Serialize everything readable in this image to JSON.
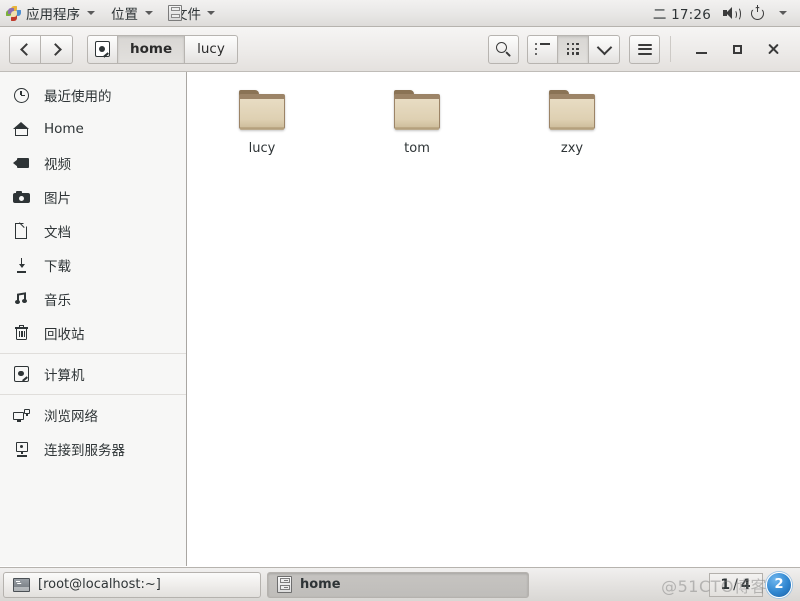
{
  "top_panel": {
    "logo_icon": "gnome-pinwheel-icon",
    "menus": [
      {
        "label": "应用程序",
        "icon": "applications-menu-icon",
        "has_caret": true
      },
      {
        "label": "位置",
        "icon": "places-menu-icon",
        "has_caret": true
      }
    ],
    "window_list": [
      {
        "label": "文件",
        "icon": "file-cabinet-icon",
        "has_caret": true
      }
    ],
    "clock": "二 17:26",
    "tray": [
      {
        "name": "volume-icon"
      },
      {
        "name": "power-icon"
      },
      {
        "name": "chevron-down-icon"
      }
    ]
  },
  "window": {
    "toolbar": {
      "back_label": "",
      "forward_label": "",
      "breadcrumb": [
        {
          "label": "",
          "icon": "drive-icon",
          "active": false
        },
        {
          "label": "home",
          "active": true
        },
        {
          "label": "lucy",
          "active": false
        }
      ],
      "search_icon": "search-icon",
      "view_buttons": [
        {
          "name": "list-view-icon",
          "active": false
        },
        {
          "name": "grid-view-icon",
          "active": true
        },
        {
          "name": "chevron-down-icon",
          "active": false
        }
      ],
      "menu_icon": "hamburger-menu-icon",
      "window_controls": [
        {
          "name": "minimize-button"
        },
        {
          "name": "maximize-button"
        },
        {
          "name": "close-button"
        }
      ]
    },
    "sidebar": {
      "items": [
        {
          "label": "最近使用的",
          "icon": "clock-icon"
        },
        {
          "label": "Home",
          "icon": "home-icon"
        },
        {
          "label": "视频",
          "icon": "video-icon"
        },
        {
          "label": "图片",
          "icon": "camera-icon"
        },
        {
          "label": "文档",
          "icon": "document-icon"
        },
        {
          "label": "下载",
          "icon": "download-icon"
        },
        {
          "label": "音乐",
          "icon": "music-icon"
        },
        {
          "label": "回收站",
          "icon": "trash-icon"
        },
        {
          "label": "计算机",
          "icon": "disk-icon"
        },
        {
          "label": "浏览网络",
          "icon": "network-icon"
        },
        {
          "label": "连接到服务器",
          "icon": "server-icon"
        }
      ]
    },
    "files": [
      {
        "name": "lucy",
        "type": "folder"
      },
      {
        "name": "tom",
        "type": "folder"
      },
      {
        "name": "zxy",
        "type": "folder"
      }
    ]
  },
  "taskbar": {
    "tasks": [
      {
        "label": "[root@localhost:~]",
        "icon": "terminal-icon",
        "active": false
      },
      {
        "label": "home",
        "icon": "file-cabinet-icon",
        "active": true
      }
    ],
    "workspace": {
      "current": "1",
      "separator": "/",
      "total": "4"
    },
    "badge": "2",
    "watermark": "@51CTO博客"
  },
  "colors": {
    "panel_bg": "#ecebea",
    "sidebar_bg": "#f7f7f6",
    "content_bg": "#ffffff",
    "folder_fill": "#ded0b2",
    "folder_edge": "#9c8467",
    "text": "#2e3436",
    "badge_blue": "#2f86d0"
  }
}
